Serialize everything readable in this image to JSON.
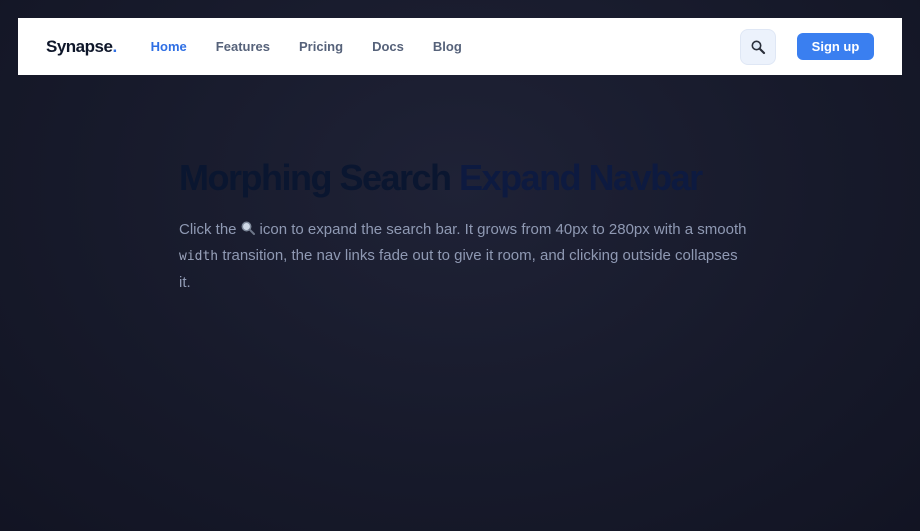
{
  "nav": {
    "brand": "Synapse",
    "brand_dot": ".",
    "links": [
      "Home",
      "Features",
      "Pricing",
      "Docs",
      "Blog"
    ],
    "active_link": "Home",
    "search_icon": "magnifier-icon",
    "signup_label": "Sign up"
  },
  "hero": {
    "title_part1": "Morphing Search ",
    "title_part2": "Expand Navbar",
    "desc_1": "Click the",
    "desc_icon": "magnifier-icon",
    "desc_2": "icon to expand the search bar. It grows from 40px to 280px with a smooth",
    "desc_code": "width",
    "desc_3": "transition, the nav links fade out to give it room, and clicking outside collapses it."
  },
  "colors": {
    "accent": "#3a7ff0",
    "background": "#171a2b",
    "nav_bg": "#ffffff"
  }
}
